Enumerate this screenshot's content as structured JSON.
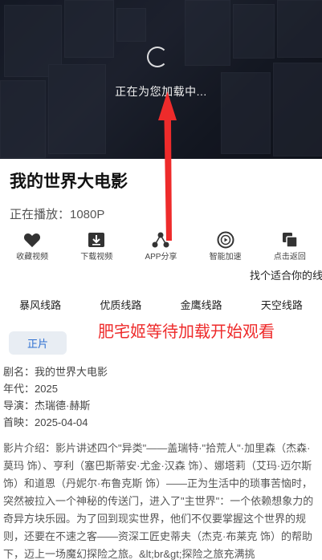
{
  "player": {
    "loading_text": "正在为您加载中..."
  },
  "movie": {
    "title": "我的世界大电影",
    "now_playing": "正在播放：1080P"
  },
  "actions": [
    {
      "label": "收藏视频",
      "icon": "heart-icon"
    },
    {
      "label": "下载视频",
      "icon": "download-icon"
    },
    {
      "label": "APP分享",
      "icon": "share-icon"
    },
    {
      "label": "智能加速",
      "icon": "play-circle-icon"
    },
    {
      "label": "点击返回",
      "icon": "copy-icon"
    }
  ],
  "route_hint": "找个适合你的线路",
  "routes": [
    "暴风线路",
    "优质线路",
    "金鹰线路",
    "天空线路"
  ],
  "overlay_note": "肥宅姬等待加载开始观看",
  "episode_button": "正片",
  "meta": {
    "name": "剧名：我的世界大电影",
    "year": "年代：2025",
    "director": "导演：杰瑞德·赫斯",
    "premiere": "首映：2025-04-04"
  },
  "synopsis": "影片介绍：影片讲述四个\"异类\"——盖瑞特·\"拾荒人\"·加里森（杰森·莫玛 饰）、亨利（塞巴斯蒂安·尤金·汉森 饰）、娜塔莉（艾玛·迈尔斯 饰）和道恩（丹妮尔·布鲁克斯 饰）——正为生活中的琐事苦恼时，突然被拉入一个神秘的传送门，进入了\"主世界\"：一个依赖想象力的奇异方块乐园。为了回到现实世界，他们不仅要掌握这个世界的规则，还要在不速之客——资深工匠史蒂夫（杰克·布莱克 饰）的帮助下，迈上一场魔幻探险之旅。&lt;br&gt;探险之旅充满挑",
  "colors": {
    "accent_blue": "#2d6fd1",
    "annotation_red": "#ee2b2b"
  }
}
